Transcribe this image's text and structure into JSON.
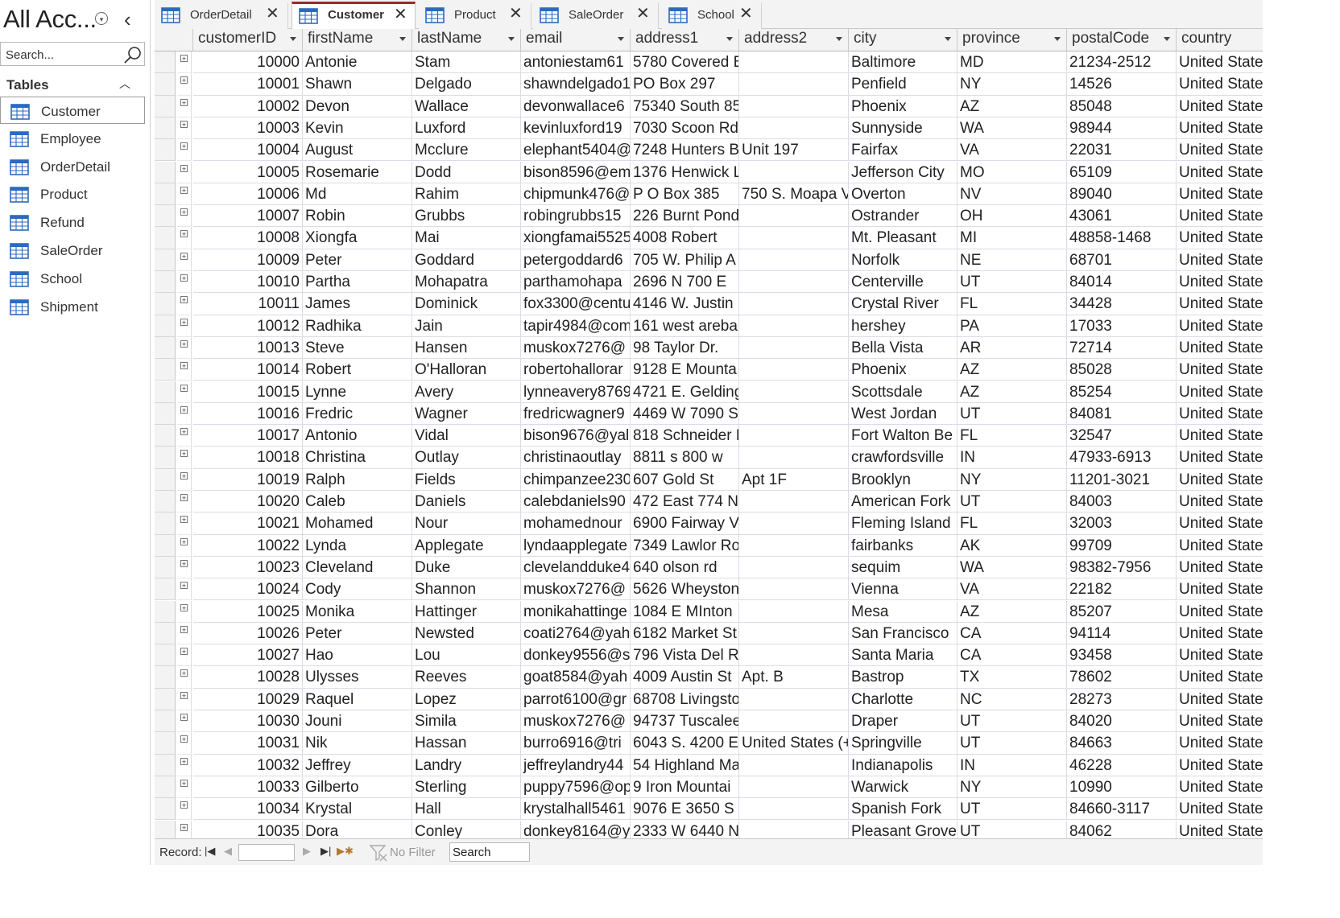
{
  "nav": {
    "title": "All Acc...",
    "search_placeholder": "Search...",
    "group_label": "Tables",
    "items": [
      {
        "label": "Customer",
        "active": true
      },
      {
        "label": "Employee"
      },
      {
        "label": "OrderDetail"
      },
      {
        "label": "Product"
      },
      {
        "label": "Refund"
      },
      {
        "label": "SaleOrder"
      },
      {
        "label": "School"
      },
      {
        "label": "Shipment"
      }
    ]
  },
  "tabs": [
    {
      "label": "OrderDetail",
      "close": "✕"
    },
    {
      "label": "Customer",
      "close": "✕",
      "active": true
    },
    {
      "label": "Product",
      "close": "✕"
    },
    {
      "label": "SaleOrder",
      "close": "✕"
    },
    {
      "label": "School",
      "close": "✕"
    }
  ],
  "grid": {
    "columns": [
      "customerID",
      "firstName",
      "lastName",
      "email",
      "address1",
      "address2",
      "city",
      "province",
      "postalCode",
      "country"
    ],
    "rows": [
      [
        "10000",
        "Antonie",
        "Stam",
        "antoniestam61",
        "5780 Covered B",
        "",
        "Baltimore",
        "MD",
        "21234-2512",
        "United State"
      ],
      [
        "10001",
        "Shawn",
        "Delgado",
        "shawndelgado1",
        "PO Box 297",
        "",
        "Penfield",
        "NY",
        "14526",
        "United State"
      ],
      [
        "10002",
        "Devon",
        "Wallace",
        "devonwallace6",
        "75340 South 85",
        "",
        "Phoenix",
        "AZ",
        "85048",
        "United State"
      ],
      [
        "10003",
        "Kevin",
        "Luxford",
        "kevinluxford19",
        "7030 Scoon Rd",
        "",
        "Sunnyside",
        "WA",
        "98944",
        "United State"
      ],
      [
        "10004",
        "August",
        "Mcclure",
        "elephant5404@",
        "7248 Hunters B",
        "Unit 197",
        "Fairfax",
        "VA",
        "22031",
        "United State"
      ],
      [
        "10005",
        "Rosemarie",
        "Dodd",
        "bison8596@em",
        "1376 Henwick L",
        "",
        "Jefferson City",
        "MO",
        "65109",
        "United State"
      ],
      [
        "10006",
        "Md",
        "Rahim",
        "chipmunk476@",
        "P O Box 385",
        "750 S. Moapa V",
        "Overton",
        "NV",
        "89040",
        "United State"
      ],
      [
        "10007",
        "Robin",
        "Grubbs",
        "robingrubbs15",
        "226 Burnt Pond",
        "",
        "Ostrander",
        "OH",
        "43061",
        "United State"
      ],
      [
        "10008",
        "Xiongfa",
        "Mai",
        "xiongfamai5525",
        "4008 Robert",
        "",
        "Mt. Pleasant",
        "MI",
        "48858-1468",
        "United State"
      ],
      [
        "10009",
        "Peter",
        "Goddard",
        "petergoddard6",
        "705 W. Philip A",
        "",
        "Norfolk",
        "NE",
        "68701",
        "United State"
      ],
      [
        "10010",
        "Partha",
        "Mohapatra",
        "parthamohapa",
        "2696 N 700 E",
        "",
        "Centerville",
        "UT",
        "84014",
        "United State"
      ],
      [
        "10011",
        "James",
        "Dominick",
        "fox3300@centu",
        "4146 W. Justin",
        "",
        "Crystal River",
        "FL",
        "34428",
        "United State"
      ],
      [
        "10012",
        "Radhika",
        "Jain",
        "tapir4984@com",
        "161 west areba",
        "",
        "hershey",
        "PA",
        "17033",
        "United State"
      ],
      [
        "10013",
        "Steve",
        "Hansen",
        "muskox7276@",
        "98 Taylor Dr.",
        "",
        "Bella Vista",
        "AR",
        "72714",
        "United State"
      ],
      [
        "10014",
        "Robert",
        "O'Halloran",
        "robertohallorar",
        "9128 E Mounta",
        "",
        "Phoenix",
        "AZ",
        "85028",
        "United State"
      ],
      [
        "10015",
        "Lynne",
        "Avery",
        "lynneavery8769",
        "4721 E. Gelding",
        "",
        "Scottsdale",
        "AZ",
        "85254",
        "United State"
      ],
      [
        "10016",
        "Fredric",
        "Wagner",
        "fredricwagner9",
        "4469 W 7090 S",
        "",
        "West Jordan",
        "UT",
        "84081",
        "United State"
      ],
      [
        "10017",
        "Antonio",
        "Vidal",
        "bison9676@yal",
        "818 Schneider D",
        "",
        "Fort Walton Be",
        "FL",
        "32547",
        "United State"
      ],
      [
        "10018",
        "Christina",
        "Outlay",
        "christinaoutlay",
        "8811 s 800 w",
        "",
        "crawfordsville",
        "IN",
        "47933-6913",
        "United State"
      ],
      [
        "10019",
        "Ralph",
        "Fields",
        "chimpanzee230",
        "607 Gold St",
        "Apt 1F",
        "Brooklyn",
        "NY",
        "11201-3021",
        "United State"
      ],
      [
        "10020",
        "Caleb",
        "Daniels",
        "calebdaniels90",
        "472 East 774 No",
        "",
        "American Fork",
        "UT",
        "84003",
        "United State"
      ],
      [
        "10021",
        "Mohamed",
        "Nour",
        "mohamednour",
        "6900 Fairway V",
        "",
        "Fleming Island",
        "FL",
        "32003",
        "United State"
      ],
      [
        "10022",
        "Lynda",
        "Applegate",
        "lyndaapplegate",
        "7349 Lawlor Ro",
        "",
        "fairbanks",
        "AK",
        "99709",
        "United State"
      ],
      [
        "10023",
        "Cleveland",
        "Duke",
        "clevelandduke4",
        "640 olson rd",
        "",
        "sequim",
        "WA",
        "98382-7956",
        "United State"
      ],
      [
        "10024",
        "Cody",
        "Shannon",
        "muskox7276@",
        "5626 Wheyston",
        "",
        "Vienna",
        "VA",
        "22182",
        "United State"
      ],
      [
        "10025",
        "Monika",
        "Hattinger",
        "monikahattinge",
        "1084 E MInton",
        "",
        "Mesa",
        "AZ",
        "85207",
        "United State"
      ],
      [
        "10026",
        "Peter",
        "Newsted",
        "coati2764@yah",
        "6182 Market St",
        "",
        "San Francisco",
        "CA",
        "94114",
        "United State"
      ],
      [
        "10027",
        "Hao",
        "Lou",
        "donkey9556@s",
        "796 Vista Del Ri",
        "",
        "Santa Maria",
        "CA",
        "93458",
        "United State"
      ],
      [
        "10028",
        "Ulysses",
        "Reeves",
        "goat8584@yah",
        "4009 Austin St",
        "Apt. B",
        "Bastrop",
        "TX",
        "78602",
        "United State"
      ],
      [
        "10029",
        "Raquel",
        "Lopez",
        "parrot6100@gr",
        "68708 Livingsto",
        "",
        "Charlotte",
        "NC",
        "28273",
        "United State"
      ],
      [
        "10030",
        "Jouni",
        "Simila",
        "muskox7276@",
        "94737 Tuscalee",
        "",
        "Draper",
        "UT",
        "84020",
        "United State"
      ],
      [
        "10031",
        "Nik",
        "Hassan",
        "burro6916@tri",
        "6043 S. 4200 E.",
        "United States (+",
        "Springville",
        "UT",
        "84663",
        "United State"
      ],
      [
        "10032",
        "Jeffrey",
        "Landry",
        "jeffreylandry44",
        "54 Highland Ma",
        "",
        "Indianapolis",
        "IN",
        "46228",
        "United State"
      ],
      [
        "10033",
        "Gilberto",
        "Sterling",
        "puppy7596@op",
        "9 Iron Mountai",
        "",
        "Warwick",
        "NY",
        "10990",
        "United State"
      ],
      [
        "10034",
        "Krystal",
        "Hall",
        "krystalhall5461",
        "9076 E 3650 S",
        "",
        "Spanish Fork",
        "UT",
        "84660-3117",
        "United State"
      ],
      [
        "10035",
        "Dora",
        "Conley",
        "donkey8164@y",
        "2333 W 6440 N",
        "",
        "Pleasant Grove",
        "UT",
        "84062",
        "United State"
      ]
    ]
  },
  "status": {
    "record_label": "Record:",
    "nav_first": "|◀",
    "nav_prev": "◀",
    "nav_next": "▶",
    "nav_last": "▶|",
    "nav_new": "▶✱",
    "record_value": "",
    "no_filter_label": "No Filter",
    "search_placeholder": "Search"
  },
  "colors": {
    "active_tab_accent": "#a4262c",
    "table_icon": "#2b6bbf"
  }
}
